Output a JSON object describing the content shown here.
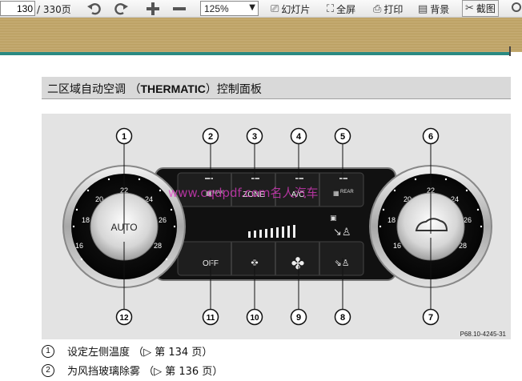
{
  "toolbar": {
    "page_current": "130",
    "page_total": "/ 330页",
    "zoom": "125%",
    "buttons": [
      "幻灯片",
      "全屏",
      "打印",
      "背景",
      "截图"
    ]
  },
  "section": {
    "title_prefix": "二区域自动空调 （",
    "title_bold": "THERMATIC",
    "title_suffix": "）控制面板"
  },
  "figure": {
    "watermark": "www.cqdpdf.com名人汽车",
    "ref_code": "P68.10-4245-31",
    "callouts": [
      "1",
      "2",
      "3",
      "4",
      "5",
      "6",
      "7",
      "8",
      "9",
      "10",
      "11",
      "12"
    ],
    "left_dial": {
      "center_label": "AUTO",
      "ticks": [
        "16",
        "18",
        "20",
        "22",
        "24",
        "26",
        "28"
      ]
    },
    "right_dial": {
      "ticks": [
        "16",
        "18",
        "20",
        "22",
        "24",
        "26",
        "28"
      ]
    },
    "buttons_top": [
      "MAX",
      "ZONE",
      "A/C",
      "REAR"
    ],
    "buttons_bottom": [
      "OFF"
    ]
  },
  "legend": [
    {
      "num": "1",
      "text": "设定左侧温度 （▷ 第 134 页）"
    },
    {
      "num": "2",
      "text": "为风挡玻璃除雾 （▷ 第 136 页）"
    }
  ],
  "colors": {
    "accent": "#2a8a82",
    "band": "#c8b078",
    "watermark": "#e23cc7"
  }
}
